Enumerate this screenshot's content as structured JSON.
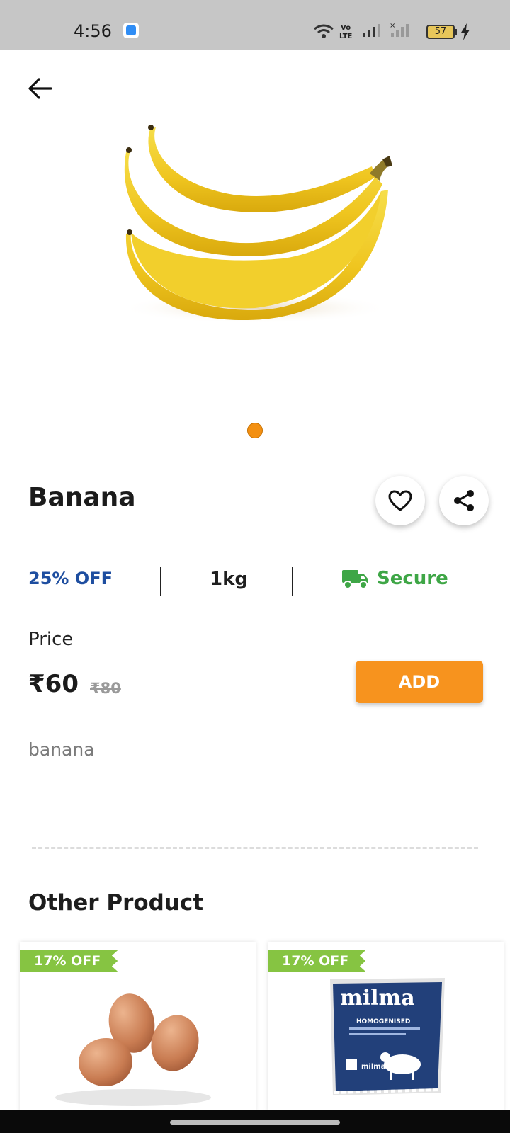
{
  "status": {
    "time": "4:56",
    "battery": "57"
  },
  "product": {
    "name": "Banana",
    "discount": "25% OFF",
    "weight": "1kg",
    "delivery": "Secure",
    "price_label": "Price",
    "price": "₹60",
    "original_price": "₹80",
    "add_label": "ADD",
    "description": "banana",
    "image_count": 1,
    "accent_color": "#f39012"
  },
  "other": {
    "title": "Other Product",
    "items": [
      {
        "badge": "17% OFF",
        "image": "eggs-image"
      },
      {
        "badge": "17% OFF",
        "image": "milma-milk-packet-image",
        "brand_text": "milma",
        "sub_text": "HOMOGENISED"
      }
    ]
  },
  "colors": {
    "discount_blue": "#1e4ea0",
    "secure_green": "#3ea646",
    "add_orange": "#f7931e",
    "badge_green": "#86c442"
  }
}
